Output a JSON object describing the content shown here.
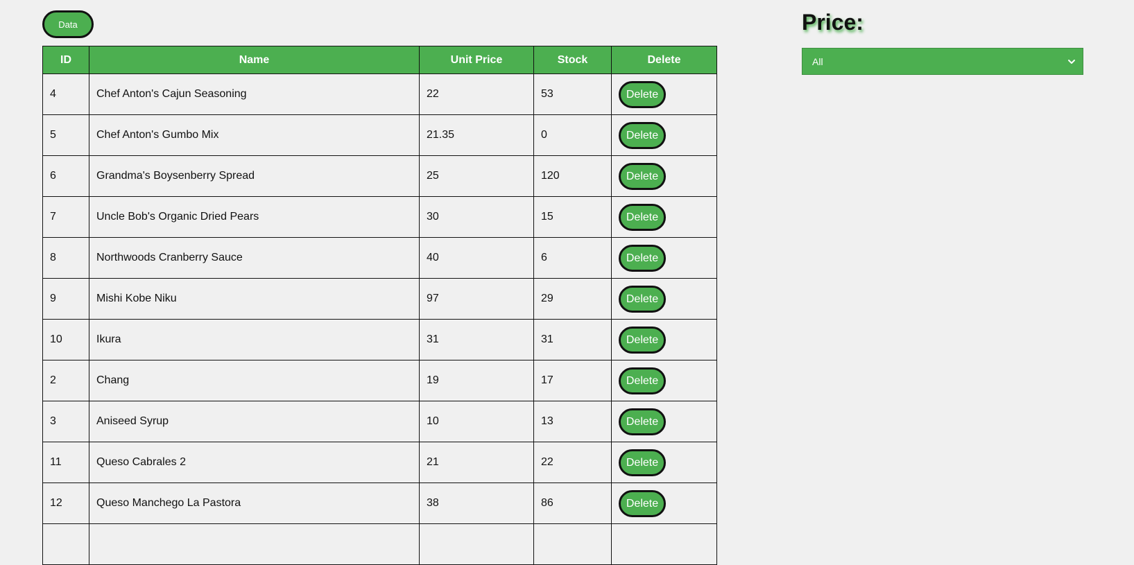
{
  "data_button_label": "Data",
  "table": {
    "headers": {
      "id": "ID",
      "name": "Name",
      "unit_price": "Unit Price",
      "stock": "Stock",
      "delete": "Delete"
    },
    "rows": [
      {
        "id": "4",
        "name": "Chef Anton's Cajun Seasoning",
        "unit_price": "22",
        "stock": "53",
        "delete_label": "Delete"
      },
      {
        "id": "5",
        "name": "Chef Anton's Gumbo Mix",
        "unit_price": "21.35",
        "stock": "0",
        "delete_label": "Delete"
      },
      {
        "id": "6",
        "name": "Grandma's Boysenberry Spread",
        "unit_price": "25",
        "stock": "120",
        "delete_label": "Delete"
      },
      {
        "id": "7",
        "name": "Uncle Bob's Organic Dried Pears",
        "unit_price": "30",
        "stock": "15",
        "delete_label": "Delete"
      },
      {
        "id": "8",
        "name": "Northwoods Cranberry Sauce",
        "unit_price": "40",
        "stock": "6",
        "delete_label": "Delete"
      },
      {
        "id": "9",
        "name": "Mishi Kobe Niku",
        "unit_price": "97",
        "stock": "29",
        "delete_label": "Delete"
      },
      {
        "id": "10",
        "name": "Ikura",
        "unit_price": "31",
        "stock": "31",
        "delete_label": "Delete"
      },
      {
        "id": "2",
        "name": "Chang",
        "unit_price": "19",
        "stock": "17",
        "delete_label": "Delete"
      },
      {
        "id": "3",
        "name": "Aniseed Syrup",
        "unit_price": "10",
        "stock": "13",
        "delete_label": "Delete"
      },
      {
        "id": "11",
        "name": "Queso Cabrales 2",
        "unit_price": "21",
        "stock": "22",
        "delete_label": "Delete"
      },
      {
        "id": "12",
        "name": "Queso Manchego La Pastora",
        "unit_price": "38",
        "stock": "86",
        "delete_label": "Delete"
      },
      {
        "id": "",
        "name": "",
        "unit_price": "",
        "stock": "",
        "delete_label": ""
      }
    ]
  },
  "price_filter": {
    "title": "Price:",
    "selected": "All",
    "icon": "chevron-down-icon"
  },
  "colors": {
    "accent": "#4caf50",
    "border": "#111111",
    "background": "#f0f0f0"
  }
}
